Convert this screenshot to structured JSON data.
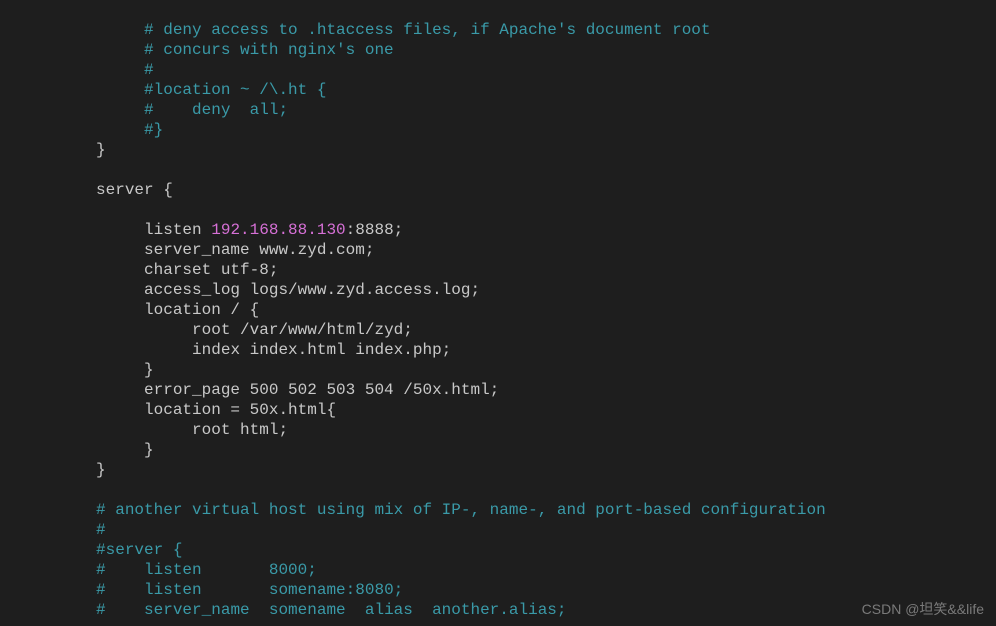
{
  "lines": [
    {
      "indent": 2,
      "parts": [
        {
          "text": "# deny access to .htaccess files, if Apache's document root",
          "class": "comment"
        }
      ]
    },
    {
      "indent": 2,
      "parts": [
        {
          "text": "# concurs with nginx's one",
          "class": "comment"
        }
      ]
    },
    {
      "indent": 2,
      "parts": [
        {
          "text": "#",
          "class": "comment"
        }
      ]
    },
    {
      "indent": 2,
      "parts": [
        {
          "text": "#location ~ /\\.ht {",
          "class": "comment"
        }
      ]
    },
    {
      "indent": 2,
      "parts": [
        {
          "text": "#    deny  all;",
          "class": "comment"
        }
      ]
    },
    {
      "indent": 2,
      "parts": [
        {
          "text": "#}",
          "class": "comment"
        }
      ]
    },
    {
      "indent": 1,
      "parts": [
        {
          "text": "}",
          "class": "default"
        }
      ]
    },
    {
      "indent": 0,
      "parts": [
        {
          "text": "",
          "class": "default"
        }
      ]
    },
    {
      "indent": 1,
      "parts": [
        {
          "text": "server {",
          "class": "default"
        }
      ]
    },
    {
      "indent": 0,
      "parts": [
        {
          "text": "",
          "class": "default"
        }
      ]
    },
    {
      "indent": 2,
      "parts": [
        {
          "text": "listen ",
          "class": "default"
        },
        {
          "text": "192.168.88.130",
          "class": "number"
        },
        {
          "text": ":8888;",
          "class": "default"
        }
      ]
    },
    {
      "indent": 2,
      "parts": [
        {
          "text": "server_name www.zyd.com;",
          "class": "default"
        }
      ]
    },
    {
      "indent": 2,
      "parts": [
        {
          "text": "charset utf-8;",
          "class": "default"
        }
      ]
    },
    {
      "indent": 2,
      "parts": [
        {
          "text": "access_log logs/www.zyd.access.log;",
          "class": "default"
        }
      ]
    },
    {
      "indent": 2,
      "parts": [
        {
          "text": "location / {",
          "class": "default"
        }
      ]
    },
    {
      "indent": 3,
      "parts": [
        {
          "text": "root /var/www/html/zyd;",
          "class": "default"
        }
      ]
    },
    {
      "indent": 3,
      "parts": [
        {
          "text": "index index.html index.php;",
          "class": "default"
        }
      ]
    },
    {
      "indent": 2,
      "parts": [
        {
          "text": "}",
          "class": "default"
        }
      ]
    },
    {
      "indent": 2,
      "parts": [
        {
          "text": "error_page 500 502 503 504 /50x.html;",
          "class": "default"
        }
      ]
    },
    {
      "indent": 2,
      "parts": [
        {
          "text": "location = 50x.html{",
          "class": "default"
        }
      ]
    },
    {
      "indent": 3,
      "parts": [
        {
          "text": "root html;",
          "class": "default"
        }
      ]
    },
    {
      "indent": 2,
      "parts": [
        {
          "text": "}",
          "class": "default"
        }
      ]
    },
    {
      "indent": 1,
      "parts": [
        {
          "text": "}",
          "class": "default"
        }
      ]
    },
    {
      "indent": 0,
      "parts": [
        {
          "text": "",
          "class": "default"
        }
      ]
    },
    {
      "indent": 1,
      "parts": [
        {
          "text": "# another virtual host using mix of IP-, name-, and port-based configuration",
          "class": "comment"
        }
      ]
    },
    {
      "indent": 1,
      "parts": [
        {
          "text": "#",
          "class": "comment"
        }
      ]
    },
    {
      "indent": 1,
      "parts": [
        {
          "text": "#server {",
          "class": "comment"
        }
      ]
    },
    {
      "indent": 1,
      "parts": [
        {
          "text": "#    listen       8000;",
          "class": "comment"
        }
      ]
    },
    {
      "indent": 1,
      "parts": [
        {
          "text": "#    listen       somename:8080;",
          "class": "comment"
        }
      ]
    },
    {
      "indent": 1,
      "parts": [
        {
          "text": "#    server_name  somename  alias  another.alias;",
          "class": "comment"
        }
      ]
    }
  ],
  "watermark": "CSDN @坦笑&&life",
  "indentSize": "     "
}
